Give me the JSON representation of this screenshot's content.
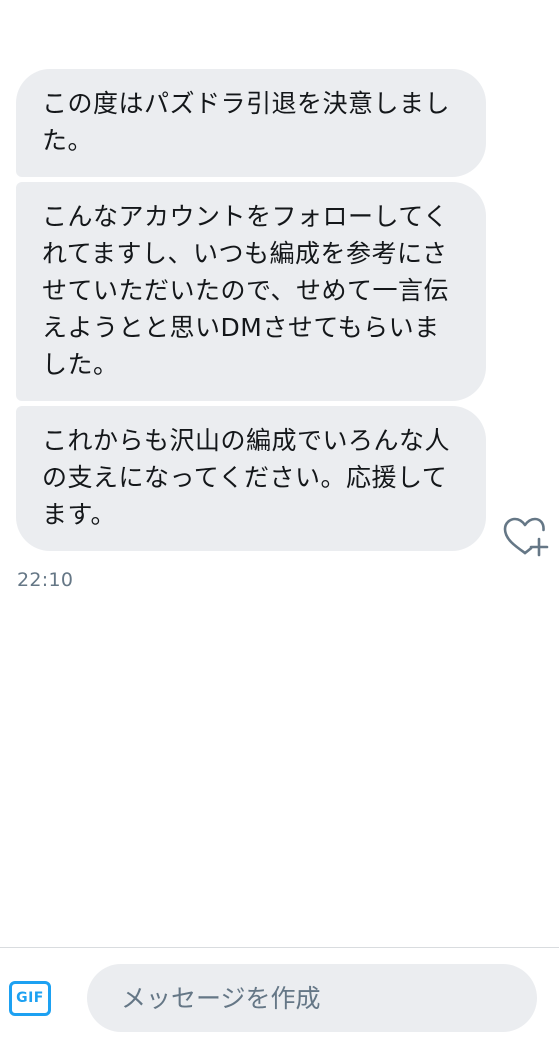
{
  "conversation": {
    "messages": [
      {
        "text": "この度はパズドラ引退を決意しました。"
      },
      {
        "text": "こんなアカウントをフォローしてくれてますし、いつも編成を参考にさせていただいたので、せめて一言伝えようとと思いDMさせてもらいました。"
      },
      {
        "text": "これからも沢山の編成でいろんな人の支えになってください。応援してます。"
      }
    ],
    "timestamp": "22:10",
    "like_icon": "heart-plus-icon"
  },
  "composer": {
    "gif_label": "GIF",
    "input_placeholder": "メッセージを作成",
    "input_value": ""
  },
  "colors": {
    "bubble_bg": "#ebedf0",
    "text": "#14171a",
    "secondary_text": "#657786",
    "accent": "#1da1f2"
  }
}
